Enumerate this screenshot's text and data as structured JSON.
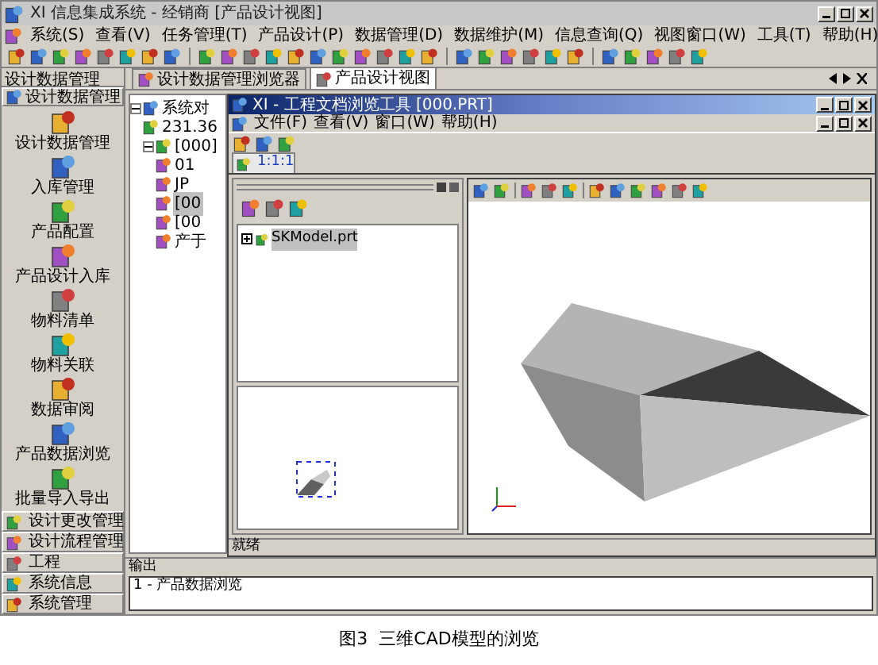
{
  "window": {
    "title": "XI 信息集成系统 - 经销商  [产品设计视图]"
  },
  "menu": [
    "系统(S)",
    "查看(V)",
    "任务管理(T)",
    "产品设计(P)",
    "数据管理(D)",
    "数据维护(M)",
    "信息查询(Q)",
    "视图窗口(W)",
    "工具(T)",
    "帮助(H)"
  ],
  "sidebar": {
    "title": "设计数据管理",
    "section": "设计数据管理",
    "items": [
      "设计数据管理",
      "入库管理",
      "产品配置",
      "产品设计入库",
      "物料清单",
      "物料关联",
      "数据审阅",
      "产品数据浏览",
      "批量导入导出"
    ],
    "groups": [
      "设计更改管理",
      "设计流程管理",
      "工程",
      "系统信息",
      "系统管理"
    ]
  },
  "tabs": [
    {
      "label": "设计数据管理浏览器",
      "selected": false
    },
    {
      "label": "产品设计视图",
      "selected": true
    }
  ],
  "tree": [
    {
      "label": "系统对",
      "expanded": true,
      "selected": false,
      "children": [
        {
          "label": "231.36",
          "selected": false
        },
        {
          "label": "[000]",
          "expanded": true,
          "selected": false,
          "children": [
            {
              "label": "01",
              "selected": false
            },
            {
              "label": "JP",
              "selected": false
            },
            {
              "label": "[00",
              "selected": true
            },
            {
              "label": "[00",
              "selected": false
            },
            {
              "label": "产于",
              "selected": false
            }
          ]
        }
      ]
    }
  ],
  "viewer": {
    "title": "XI - 工程文档浏览工具 [000.PRT]",
    "menu": [
      "文件(F)",
      "查看(V)",
      "窗口(W)",
      "帮助(H)"
    ],
    "tab": {
      "label": "1:1:1",
      "selected": true
    },
    "model_tree": [
      {
        "label": "SKModel.prt",
        "selected": true
      }
    ],
    "status": "就绪"
  },
  "output": {
    "title": "输出",
    "lines": [
      "1 - 产品数据浏览"
    ]
  },
  "caption": "图3  三维CAD模型的浏览"
}
